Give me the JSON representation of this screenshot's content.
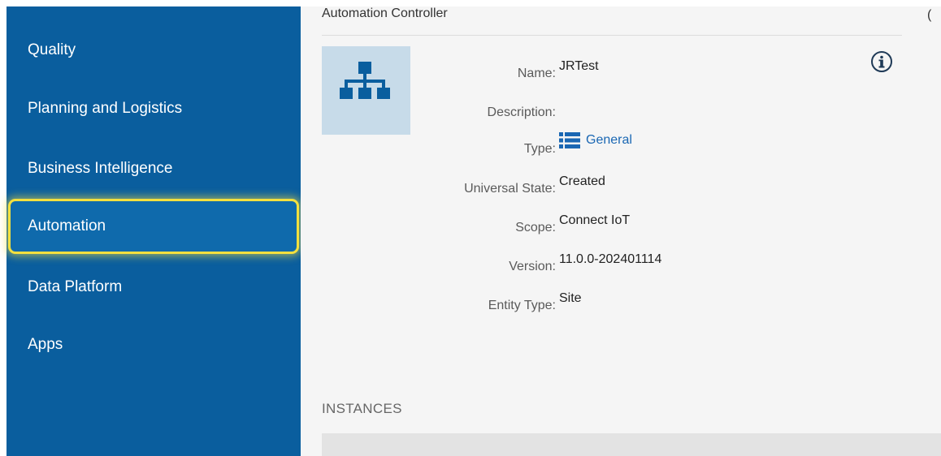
{
  "sidebar": {
    "items": [
      {
        "label": "Quality",
        "active": false
      },
      {
        "label": "Planning and Logistics",
        "active": false
      },
      {
        "label": "Business Intelligence",
        "active": false
      },
      {
        "label": "Automation",
        "active": true
      },
      {
        "label": "Data Platform",
        "active": false
      },
      {
        "label": "Apps",
        "active": false
      }
    ]
  },
  "panel": {
    "title": "Automation Controller",
    "edge_glyph": "(",
    "entity_icon": "hierarchy-icon",
    "info_icon": "info-icon",
    "properties": {
      "name": {
        "label": "Name:",
        "value": "JRTest"
      },
      "description": {
        "label": "Description:",
        "value": ""
      },
      "type": {
        "label": "Type:",
        "value": "General",
        "icon": "list-icon"
      },
      "universal_state": {
        "label": "Universal State:",
        "value": "Created"
      },
      "scope": {
        "label": "Scope:",
        "value": "Connect IoT"
      },
      "version": {
        "label": "Version:",
        "value": "11.0.0-202401114"
      },
      "entity_type": {
        "label": "Entity Type:",
        "value": "Site"
      }
    },
    "instances_title": "INSTANCES"
  },
  "colors": {
    "sidebar_bg": "#0a5e9e",
    "highlight": "#f3e03f",
    "link": "#1a67b3",
    "entity_box": "#c7dbe9"
  }
}
